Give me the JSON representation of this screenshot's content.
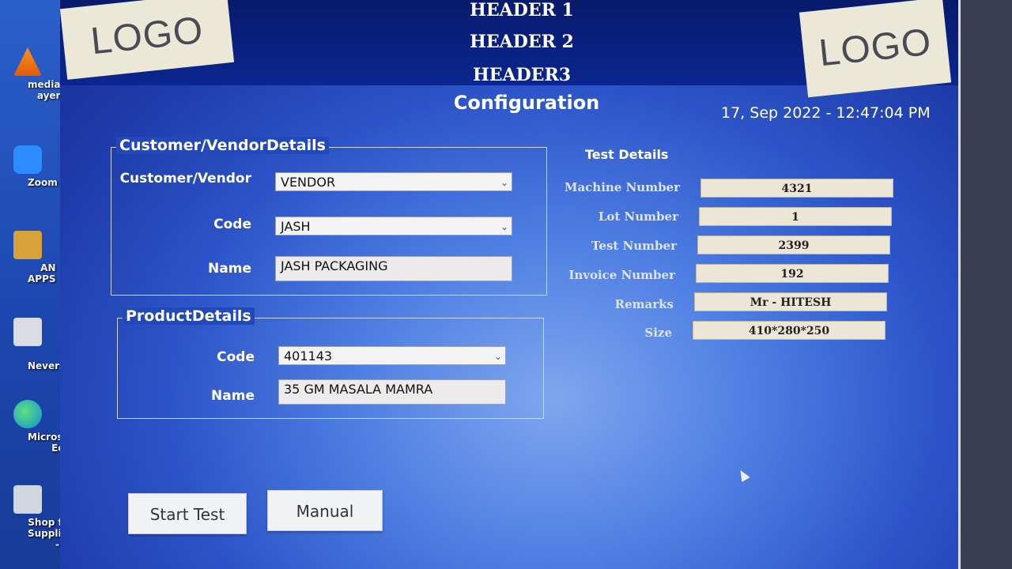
{
  "desktop": {
    "icons": [
      {
        "label": "media\nayer",
        "icon": "vlc-cone-icon"
      },
      {
        "label": "Zoom",
        "icon": "zoom-camera-icon"
      },
      {
        "label": "AN APPS",
        "icon": "apps-folder-icon"
      },
      {
        "label": "HP\nNeverst...",
        "icon": "printer-icon"
      },
      {
        "label": "Microsoft\nEdge",
        "icon": "edge-icon"
      },
      {
        "label": "Shop for\nSupplies - ...",
        "icon": "shop-printer-icon"
      }
    ]
  },
  "header": {
    "logo_left": "LOGO",
    "logo_right": "LOGO",
    "line1": "HEADER 1",
    "line2": "HEADER 2",
    "line3": "HEADER3",
    "title": "Configuration",
    "datetime": "17, Sep 2022  - 12:47:04 PM"
  },
  "customer": {
    "group_title": "Customer/VendorDetails",
    "type_label": "Customer/Vendor",
    "type_value": "VENDOR",
    "code_label": "Code",
    "code_value": "JASH",
    "name_label": "Name",
    "name_value": "JASH PACKAGING"
  },
  "product": {
    "group_title": "ProductDetails",
    "code_label": "Code",
    "code_value": "401143",
    "name_label": "Name",
    "name_value": "35 GM MASALA MAMRA"
  },
  "test_details": {
    "title": "Test Details",
    "rows": [
      {
        "label": "Machine Number",
        "value": "4321"
      },
      {
        "label": "Lot Number",
        "value": "1"
      },
      {
        "label": "Test Number",
        "value": "2399"
      },
      {
        "label": "Invoice Number",
        "value": "192"
      },
      {
        "label": "Remarks",
        "value": "Mr - HITESH"
      },
      {
        "label": "Size",
        "value": "410*280*250"
      }
    ]
  },
  "buttons": {
    "start": "Start Test",
    "manual": "Manual"
  },
  "colors": {
    "header_bg": "#0b2690",
    "panel_bg": "#2c54c8",
    "logo_bg": "#ebe8d8"
  }
}
